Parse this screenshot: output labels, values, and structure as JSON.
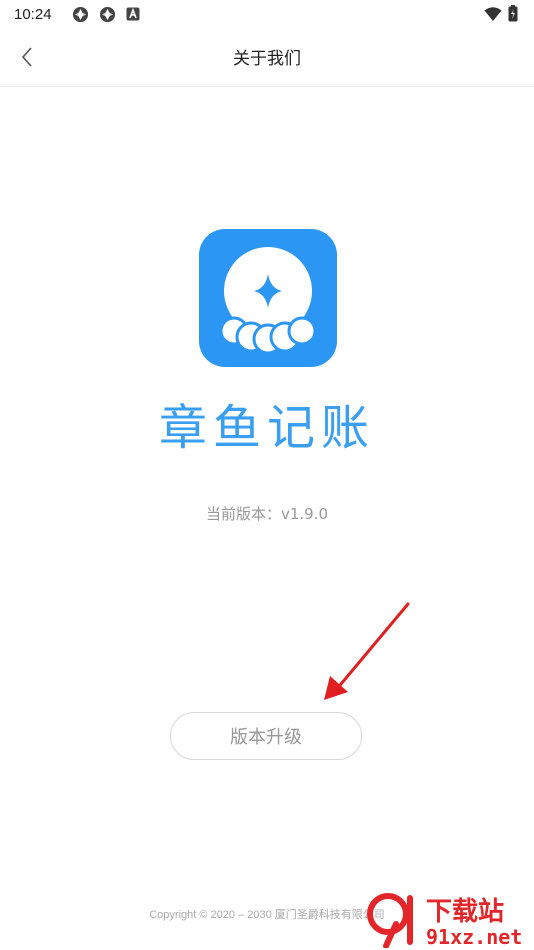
{
  "status_bar": {
    "time": "10:24",
    "icons": [
      "app-notification-icon",
      "app-notification-icon",
      "a-icon",
      "wifi-icon",
      "battery-icon"
    ]
  },
  "header": {
    "title": "关于我们",
    "back_icon": "chevron-left-icon"
  },
  "app": {
    "name": "章鱼记账",
    "version_label": "当前版本：v1.9.0",
    "brand_color": "#2b96f4"
  },
  "upgrade_button": {
    "label": "版本升级"
  },
  "footer": {
    "copyright": "Copyright © 2020 – 2030 厦门圣爵科技有限公司"
  },
  "watermark": {
    "text_top": "下载站",
    "text_bottom": "91xz.net"
  },
  "colors": {
    "accent": "#3a9ff2",
    "arrow": "#e02020",
    "watermark": "#e3262a"
  }
}
